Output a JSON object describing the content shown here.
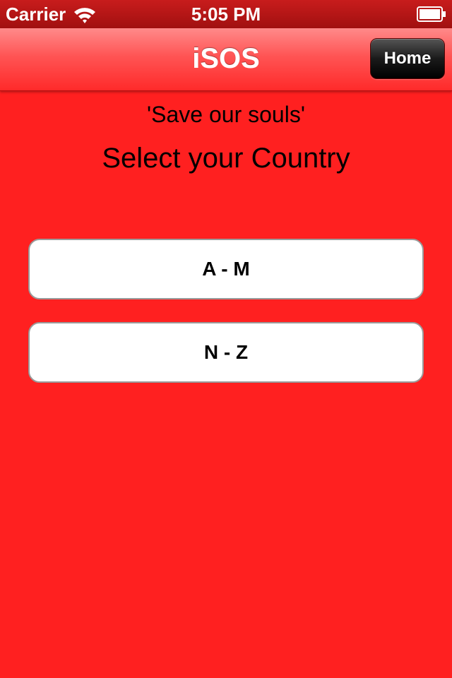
{
  "status_bar": {
    "carrier": "Carrier",
    "time": "5:05 PM",
    "icons": [
      "wifi-icon",
      "battery-icon"
    ]
  },
  "nav_bar": {
    "title": "iSOS",
    "home_label": "Home"
  },
  "main": {
    "tagline": "'Save our souls'",
    "heading": "Select your Country",
    "buttons": [
      {
        "label": "A - M"
      },
      {
        "label": "N - Z"
      }
    ]
  },
  "colors": {
    "background": "#ff2020",
    "nav_bar": "#ff5454",
    "home_button": "#000000",
    "button_fill": "#ffffff"
  }
}
